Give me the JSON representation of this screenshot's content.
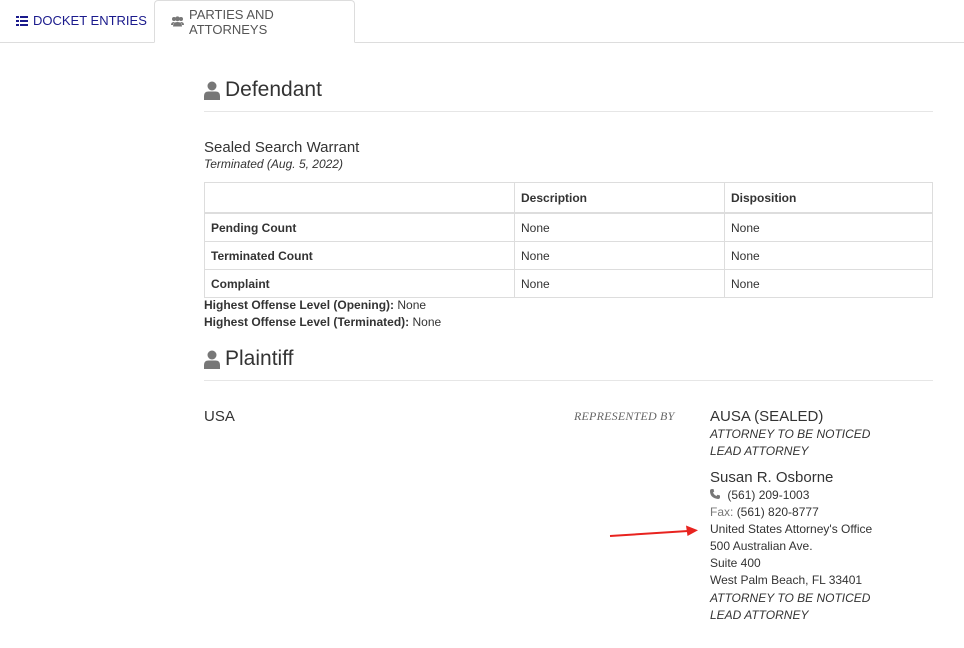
{
  "tabs": [
    {
      "label": "DOCKET ENTRIES",
      "icon": "list-icon"
    },
    {
      "label": "PARTIES AND ATTORNEYS",
      "icon": "users-icon"
    }
  ],
  "defendant": {
    "heading": "Defendant",
    "name": "Sealed Search Warrant",
    "status": "Terminated (Aug. 5, 2022)",
    "table": {
      "headers": [
        "",
        "Description",
        "Disposition"
      ],
      "rows": [
        {
          "label": "Pending Count",
          "description": "None",
          "disposition": "None"
        },
        {
          "label": "Terminated Count",
          "description": "None",
          "disposition": "None"
        },
        {
          "label": "Complaint",
          "description": "None",
          "disposition": "None"
        }
      ]
    },
    "offense_opening_label": "Highest Offense Level (Opening):",
    "offense_opening_value": "None",
    "offense_terminated_label": "Highest Offense Level (Terminated):",
    "offense_terminated_value": "None"
  },
  "plaintiff": {
    "heading": "Plaintiff",
    "name": "USA",
    "represented_by": "REPRESENTED BY",
    "attorneys": [
      {
        "name": "AUSA (SEALED)",
        "notes": [
          "ATTORNEY TO BE NOTICED",
          "LEAD ATTORNEY"
        ]
      },
      {
        "name": "Susan R. Osborne",
        "phone": "(561) 209-1003",
        "fax_label": "Fax:",
        "fax": "(561) 820-8777",
        "address": [
          "United States Attorney's Office",
          "500 Australian Ave.",
          "Suite 400",
          "West Palm Beach, FL 33401"
        ],
        "notes": [
          "ATTORNEY TO BE NOTICED",
          "LEAD ATTORNEY"
        ]
      }
    ]
  },
  "colors": {
    "tab_active_text": "#555555",
    "tab_link": "#1a1a8c",
    "arrow": "#e8231f",
    "border": "#dddddd"
  }
}
